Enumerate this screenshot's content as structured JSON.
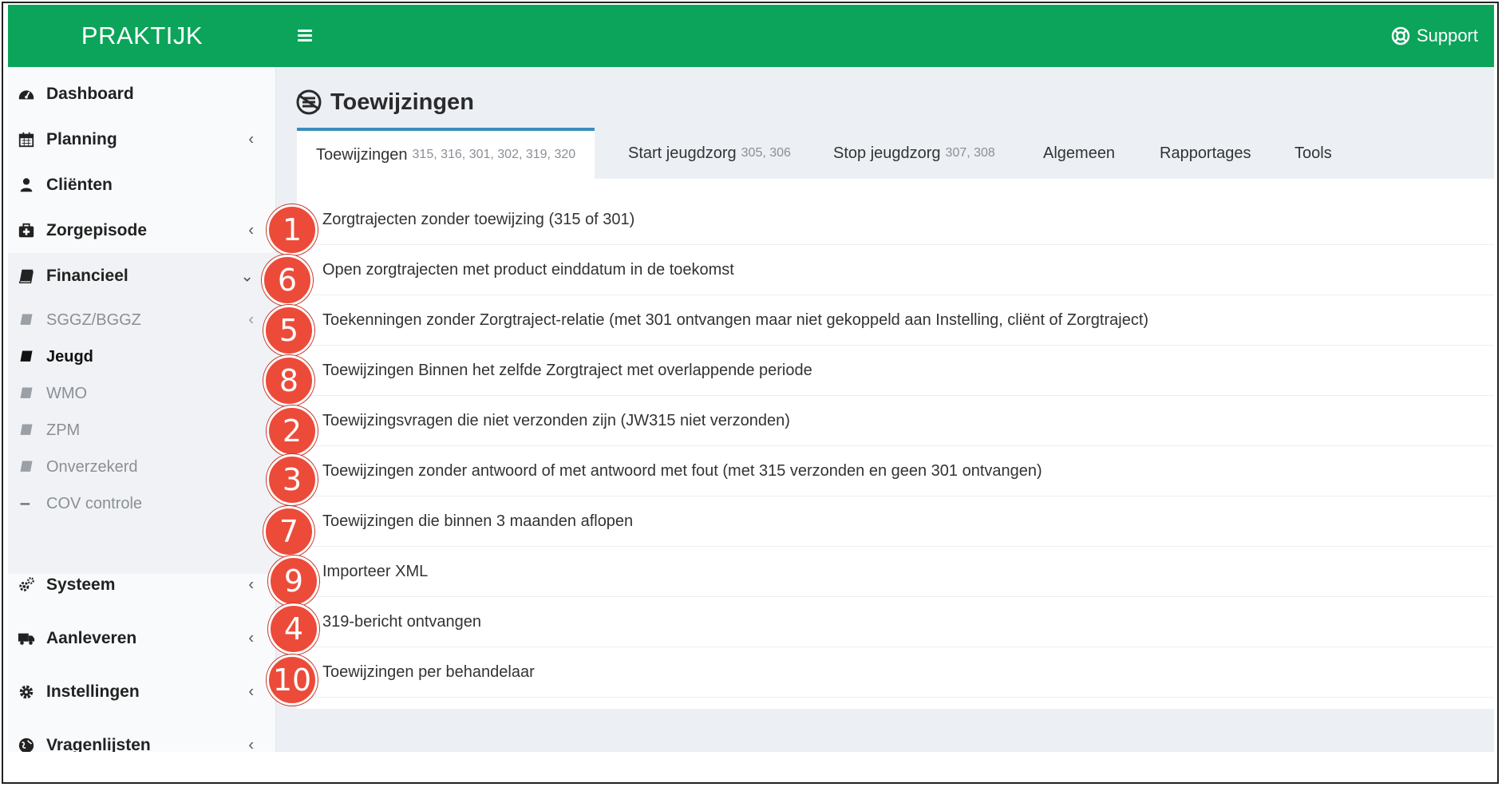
{
  "header": {
    "brand": "PRAKTIJK",
    "support_label": "Support",
    "color": "#0ba45a"
  },
  "sidebar": {
    "items": [
      {
        "label": "Dashboard",
        "icon": "dashboard-icon"
      },
      {
        "label": "Planning",
        "icon": "calendar-icon"
      },
      {
        "label": "Cliënten",
        "icon": "user-icon"
      },
      {
        "label": "Zorgepisode",
        "icon": "medkit-icon"
      },
      {
        "label": "Financieel",
        "icon": "book-icon"
      },
      {
        "label": "Systeem",
        "icon": "cogs-icon"
      },
      {
        "label": "Aanleveren",
        "icon": "truck-icon"
      },
      {
        "label": "Instellingen",
        "icon": "gear-icon"
      },
      {
        "label": "Vragenlijsten",
        "icon": "globe-icon"
      }
    ],
    "submenu": [
      {
        "label": "SGGZ/BGGZ"
      },
      {
        "label": "Jeugd"
      },
      {
        "label": "WMO"
      },
      {
        "label": "ZPM"
      },
      {
        "label": "Onverzekerd"
      },
      {
        "label": "COV controle"
      }
    ]
  },
  "page": {
    "title": "Toewijzingen"
  },
  "tabs": [
    {
      "label": "Toewijzingen",
      "codes": "315, 316, 301, 302, 319, 320"
    },
    {
      "label": "Start jeugdzorg",
      "codes": "305, 306"
    },
    {
      "label": "Stop jeugdzorg",
      "codes": "307, 308"
    },
    {
      "label": "Algemeen"
    },
    {
      "label": "Rapportages"
    },
    {
      "label": "Tools"
    }
  ],
  "links": [
    {
      "text": "Zorgtrajecten zonder toewijzing (315 of 301)",
      "badge": "1"
    },
    {
      "text": "Open zorgtrajecten met product einddatum in de toekomst",
      "badge": "6"
    },
    {
      "text": "Toekenningen zonder Zorgtraject-relatie (met 301 ontvangen maar niet gekoppeld aan Instelling, cliënt of Zorgtraject)",
      "badge": "5"
    },
    {
      "text": "Toewijzingen Binnen het zelfde Zorgtraject met overlappende periode",
      "badge": "8"
    },
    {
      "text": "Toewijzingsvragen die niet verzonden zijn (JW315 niet verzonden)",
      "badge": "2"
    },
    {
      "text": "Toewijzingen zonder antwoord of met antwoord met fout (met 315 verzonden en geen 301 ontvangen)",
      "badge": "3"
    },
    {
      "text": "Toewijzingen die binnen 3 maanden aflopen",
      "badge": "7"
    },
    {
      "text": "Importeer XML",
      "badge": "9"
    },
    {
      "text": "319-bericht ontvangen",
      "badge": "4"
    },
    {
      "text": "Toewijzingen per behandelaar",
      "badge": "10"
    }
  ],
  "colors": {
    "badge": "#ec4b3a",
    "active_tab_border": "#3c8dbc"
  }
}
